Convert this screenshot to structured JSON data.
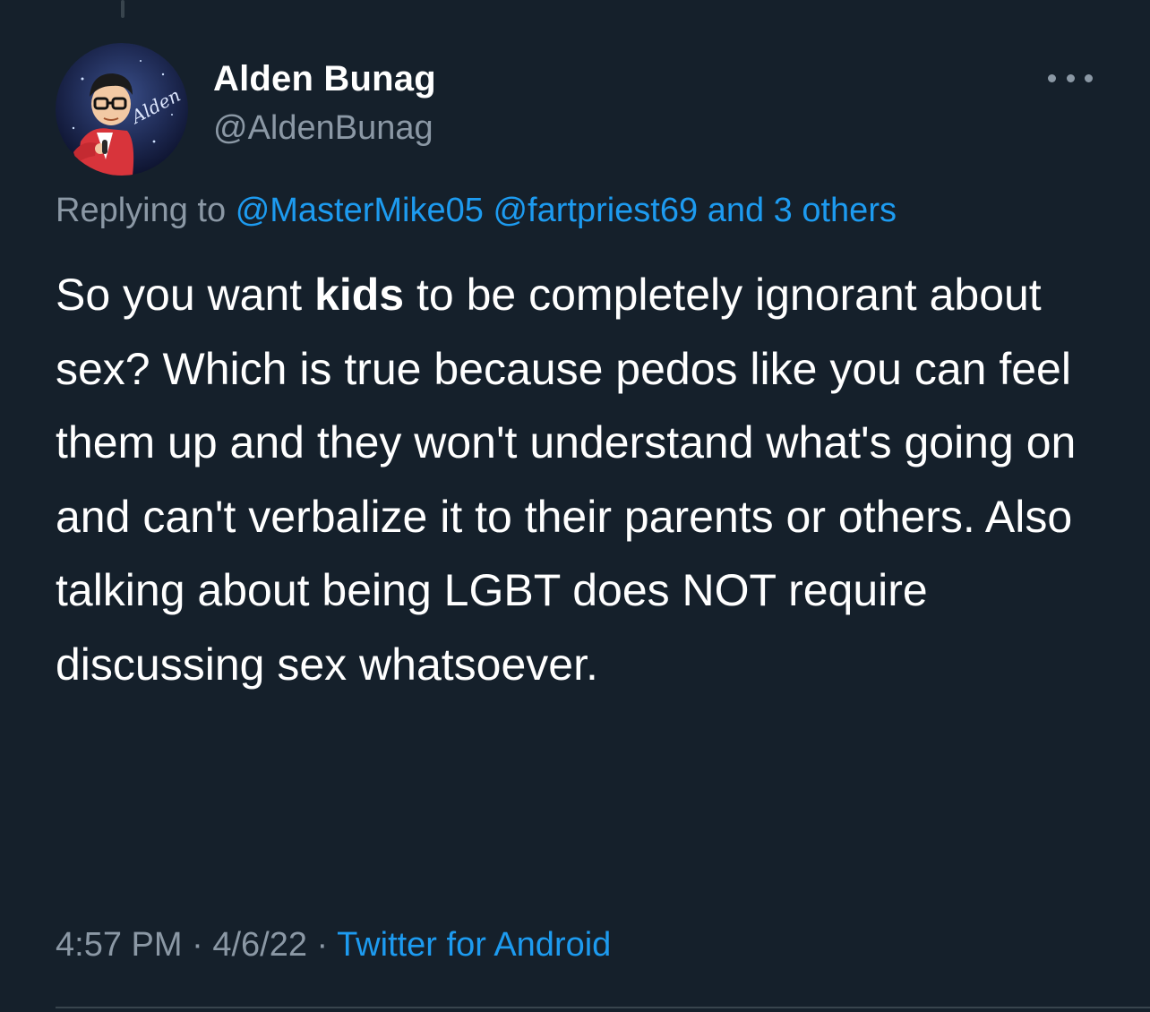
{
  "author": {
    "display_name": "Alden Bunag",
    "handle": "@AldenBunag",
    "avatar_signature": "Alden"
  },
  "more_icon": "more-horizontal-icon",
  "reply_context": {
    "prefix": "Replying to",
    "mention_1": "@MasterMike05",
    "mention_2": "@fartpriest69",
    "others": "and 3 others"
  },
  "tweet": {
    "text_before": "So you want ",
    "highlight": "kids",
    "text_after": " to be completely ignorant about sex? Which is true because pedos like you can feel them up and they won't understand what's going on and can't verbalize it to their parents or others. Also talking about being LGBT does NOT require discussing sex whatsoever."
  },
  "meta": {
    "time": "4:57 PM",
    "sep1": " · ",
    "date": "4/6/22",
    "sep2": " · ",
    "source": "Twitter for Android"
  },
  "colors": {
    "background": "#15202b",
    "link": "#1d9bf0",
    "secondary": "#8b98a5"
  }
}
